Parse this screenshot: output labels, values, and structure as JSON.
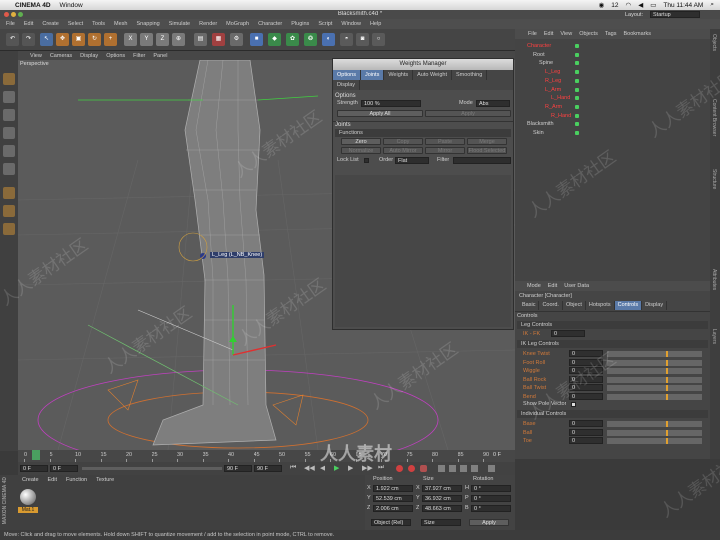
{
  "macbar": {
    "apple": "",
    "app": "CINEMA 4D",
    "menu": "Window",
    "status_num": "12",
    "clock": "Thu 11:44 AM"
  },
  "window": {
    "title": "Blacksmith.c4d *",
    "layout_label": "Layout:",
    "layout_value": "Startup"
  },
  "main_menu": [
    "File",
    "Edit",
    "Create",
    "Select",
    "Tools",
    "Mesh",
    "Snapping",
    "Simulate",
    "Render",
    "MoGraph",
    "Character",
    "Plugins",
    "Script",
    "Window",
    "Help"
  ],
  "viewport": {
    "menu": [
      "View",
      "Cameras",
      "Display",
      "Options",
      "Filter",
      "Panel"
    ],
    "label": "Perspective",
    "joint_tag": "L_Leg (L_NB_Knee)"
  },
  "weights_manager": {
    "title": "Weights Manager",
    "tabs": [
      "Options",
      "Joints",
      "Weights",
      "Auto Weight",
      "Smoothing"
    ],
    "tab2": "Display",
    "options_head": "Options",
    "strength_label": "Strength",
    "strength_value": "100 %",
    "mode_label": "Mode",
    "mode_value": "Abs",
    "apply_all": "Apply All",
    "apply": "Apply",
    "joints_head": "Joints",
    "functions_head": "Functions",
    "fn_row1": [
      "Zero",
      "Copy",
      "Paste",
      "Merge"
    ],
    "fn_row2": [
      "Normalize",
      "Auto Mirror",
      "Mirror",
      "Flood Selected"
    ],
    "lock_list_label": "Lock List",
    "order_label": "Order",
    "order_value": "Flat",
    "filter_label": "Filter"
  },
  "object_manager": {
    "menu": [
      "File",
      "Edit",
      "View",
      "Objects",
      "Tags",
      "Bookmarks"
    ],
    "rows": [
      {
        "label": "Character",
        "red": true
      },
      {
        "label": "Root",
        "red": false
      },
      {
        "label": "Spine",
        "red": false
      },
      {
        "label": "L_Leg",
        "red": true
      },
      {
        "label": "R_Leg",
        "red": true
      },
      {
        "label": "L_Arm",
        "red": true
      },
      {
        "label": "L_Hand",
        "red": true
      },
      {
        "label": "R_Arm",
        "red": true
      },
      {
        "label": "R_Hand",
        "red": true
      },
      {
        "label": "Blacksmith",
        "red": false
      },
      {
        "label": "Skin",
        "red": false
      }
    ]
  },
  "attributes": {
    "menu": [
      "Mode",
      "Edit",
      "User Data"
    ],
    "object_title": "Character [Character]",
    "tabs": [
      "Basic",
      "Coord.",
      "Object",
      "Hotspots",
      "Controls",
      "Display"
    ],
    "controls_head": "Controls",
    "leg_controls": "Leg Controls",
    "ik_fk_label": "IK - FK",
    "ik_fk_value": "0",
    "ik_leg_controls": "IK Leg Controls",
    "params": [
      {
        "label": "Knee Twist",
        "value": "0"
      },
      {
        "label": "Foot Roll",
        "value": "0"
      },
      {
        "label": "Wiggle",
        "value": "0"
      },
      {
        "label": "Ball Rock",
        "value": "0"
      },
      {
        "label": "Ball Twist",
        "value": "0"
      },
      {
        "label": "Bend",
        "value": "0"
      }
    ],
    "show_pole": "Show Pole Vector",
    "individual": "Individual Controls",
    "ind_params": [
      {
        "label": "Base",
        "value": "0"
      },
      {
        "label": "Ball",
        "value": "0"
      },
      {
        "label": "Toe",
        "value": "0"
      }
    ]
  },
  "right_strip": [
    "Objects",
    "Content Browser",
    "Structure",
    "Attributes",
    "Layers"
  ],
  "timeline": {
    "ticks": [
      "0",
      "5",
      "10",
      "15",
      "20",
      "25",
      "30",
      "35",
      "40",
      "45",
      "50",
      "55",
      "60",
      "65",
      "70",
      "75",
      "80",
      "85",
      "90"
    ],
    "current": "0 F",
    "start": "0 F",
    "start2": "0 F",
    "end": "90 F",
    "end2": "90 F"
  },
  "material_manager": {
    "menu": [
      "Create",
      "Edit",
      "Function",
      "Texture"
    ],
    "material": "Mat.1"
  },
  "coordinates": {
    "headers": [
      "Position",
      "Size",
      "Rotation"
    ],
    "rows": [
      {
        "axis": "X",
        "pos": "1.922 cm",
        "sizeax": "X",
        "size": "37.927 cm",
        "rotax": "H",
        "rot": "0 °"
      },
      {
        "axis": "Y",
        "pos": "52.539 cm",
        "sizeax": "Y",
        "size": "36.932 cm",
        "rotax": "P",
        "rot": "0 °"
      },
      {
        "axis": "Z",
        "pos": "2.006 cm",
        "sizeax": "Z",
        "size": "48.663 cm",
        "rotax": "B",
        "rot": "0 °"
      }
    ],
    "mode": "Object (Rel)",
    "size_mode": "Size",
    "apply": "Apply"
  },
  "status_text": "Move: Click and drag to move elements. Hold down SHIFT to quantize movement / add to the selection in point mode, CTRL to remove.",
  "side_logo": "MAXON CINEMA 4D",
  "watermark": "人人素材社区",
  "watermark_brand": "人人素材",
  "colors": {
    "accent": "#5a7aa8",
    "joint_red": "#ff4040",
    "orange": "#d27a3a"
  }
}
